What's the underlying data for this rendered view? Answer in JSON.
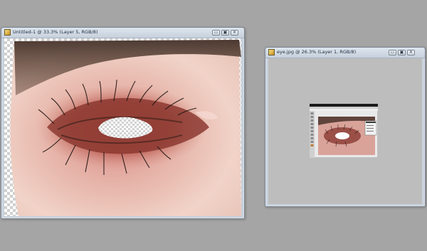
{
  "desktop": {
    "background": "#a5a5a5"
  },
  "window_left": {
    "title": "Untitled-1 @ 33.3% (Layer 5, RGB/8)",
    "controls": {
      "minimize": "▭",
      "restore": "▣",
      "close": "✕"
    },
    "canvas": {
      "image": "eye-with-transparent-hole",
      "transparency": "checkerboard"
    }
  },
  "window_right": {
    "title": "eye.jpg @ 26.3% (Layer 1, RGB/8)",
    "controls": {
      "minimize": "▭",
      "restore": "▣",
      "close": "✕"
    },
    "canvas": {
      "background": "#bdbdbd",
      "thumbnail": "photoshop-screenshot-of-eye"
    }
  }
}
